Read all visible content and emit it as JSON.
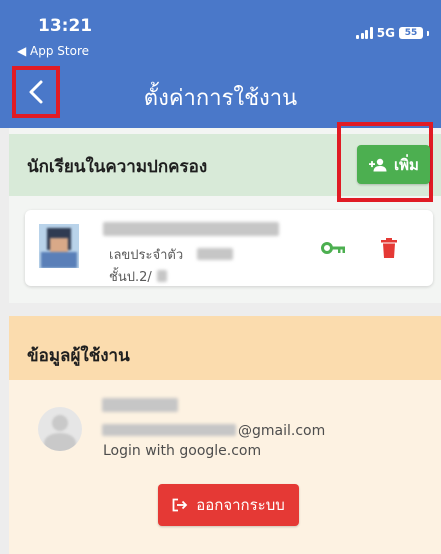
{
  "status_bar": {
    "time": "13:21",
    "back_app": "◀ App Store",
    "network": "5G",
    "battery": "55"
  },
  "header": {
    "title": "ตั้งค่าการใช้งาน",
    "back_icon": "chevron-left-icon",
    "color": "#4a78c9"
  },
  "students": {
    "title": "นักเรียนในความปกครอง",
    "add_button_label": "เพิ่ม",
    "items": [
      {
        "id_label": "เลขประจำตัว",
        "class_label": "ชั้นป.2/"
      }
    ],
    "key_color": "#4caf50",
    "delete_color": "#e53935"
  },
  "user": {
    "title": "ข้อมูลผู้ใช้งาน",
    "email_suffix": "@gmail.com",
    "login_method": "Login with google.com",
    "logout_label": "ออกจากระบบ"
  }
}
